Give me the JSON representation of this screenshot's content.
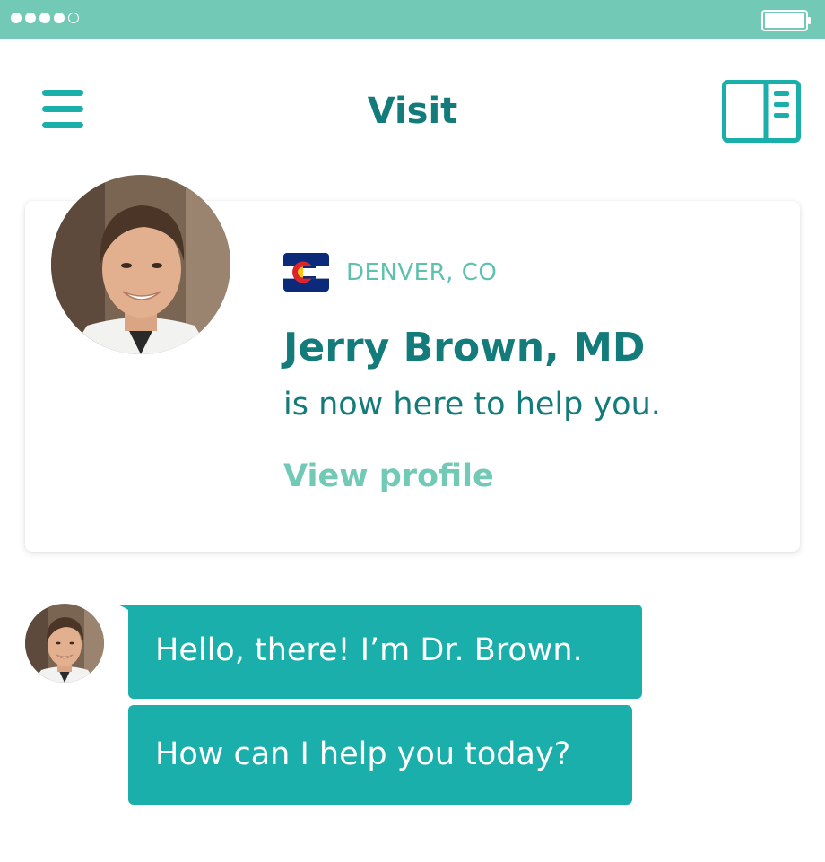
{
  "status_bar": {
    "signal_dots_filled": 4,
    "signal_dots_total": 5,
    "battery_icon": "battery-icon",
    "color": "#72c9b6"
  },
  "header": {
    "title": "Visit",
    "menu_icon": "hamburger-menu-icon",
    "book_icon": "book-panel-icon"
  },
  "doctor_card": {
    "location": "DENVER, CO",
    "flag_icon": "colorado-flag-icon",
    "name": "Jerry Brown, MD",
    "help_text": "is now here to help you.",
    "view_profile": "View profile"
  },
  "chat": {
    "messages": [
      {
        "text": "Hello, there! I’m Dr. Brown."
      },
      {
        "text": "How can I help you today?"
      }
    ]
  },
  "colors": {
    "accent": "#1aafaa",
    "dark_teal": "#137c7a",
    "light_teal": "#72c9b6",
    "location_text": "#5ec1ad"
  }
}
